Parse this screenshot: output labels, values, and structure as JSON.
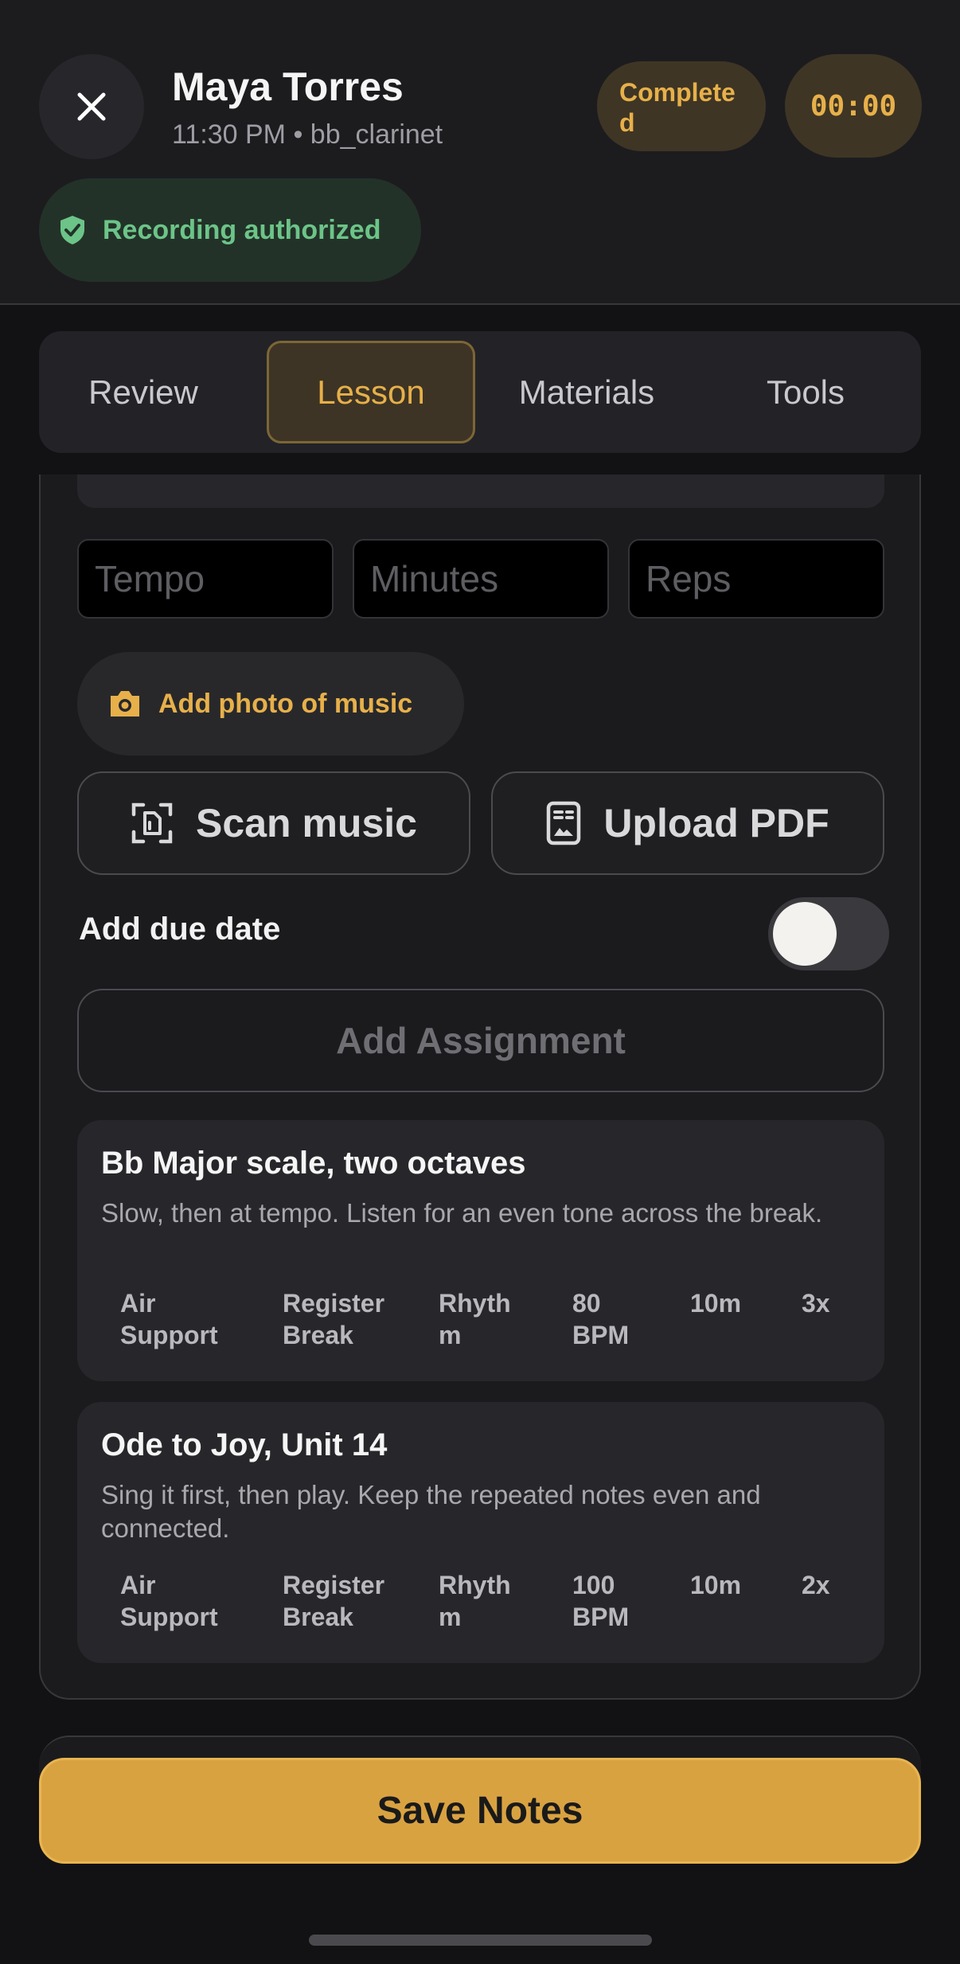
{
  "header": {
    "client_name": "Maya Torres",
    "meta": "11:30 PM • bb_clarinet",
    "status": "Completed",
    "timer": "00:00",
    "recording": "Recording authorized"
  },
  "tabs": [
    {
      "label": "Review",
      "active": false
    },
    {
      "label": "Lesson",
      "active": true
    },
    {
      "label": "Materials",
      "active": false
    },
    {
      "label": "Tools",
      "active": false
    }
  ],
  "form": {
    "tempo_placeholder": "Tempo",
    "minutes_placeholder": "Minutes",
    "reps_placeholder": "Reps",
    "add_photo": "Add photo of music",
    "scan_music": "Scan music",
    "upload_pdf": "Upload PDF",
    "due_date_label": "Add due date",
    "due_date_enabled": false,
    "add_assignment": "Add Assignment"
  },
  "assignments": [
    {
      "title": "Bb Major scale, two octaves",
      "description": "Slow, then at tempo. Listen for an even tone across the break.",
      "tags": [
        "Air Support",
        "Register Break",
        "Rhythm"
      ],
      "tempo": "80 BPM",
      "minutes": "10m",
      "reps": "3x"
    },
    {
      "title": "Ode to Joy, Unit 14",
      "description": "Sing it first, then play. Keep the repeated notes even and connected.",
      "tags": [
        "Air Support",
        "Register Break",
        "Rhythm"
      ],
      "tempo": "100 BPM",
      "minutes": "10m",
      "reps": "2x"
    }
  ],
  "footer": {
    "save_label": "Save Notes"
  },
  "colors": {
    "accent": "#e7b04a",
    "save_button": "#d9a241",
    "success": "#6cc488",
    "background": "#121214"
  }
}
